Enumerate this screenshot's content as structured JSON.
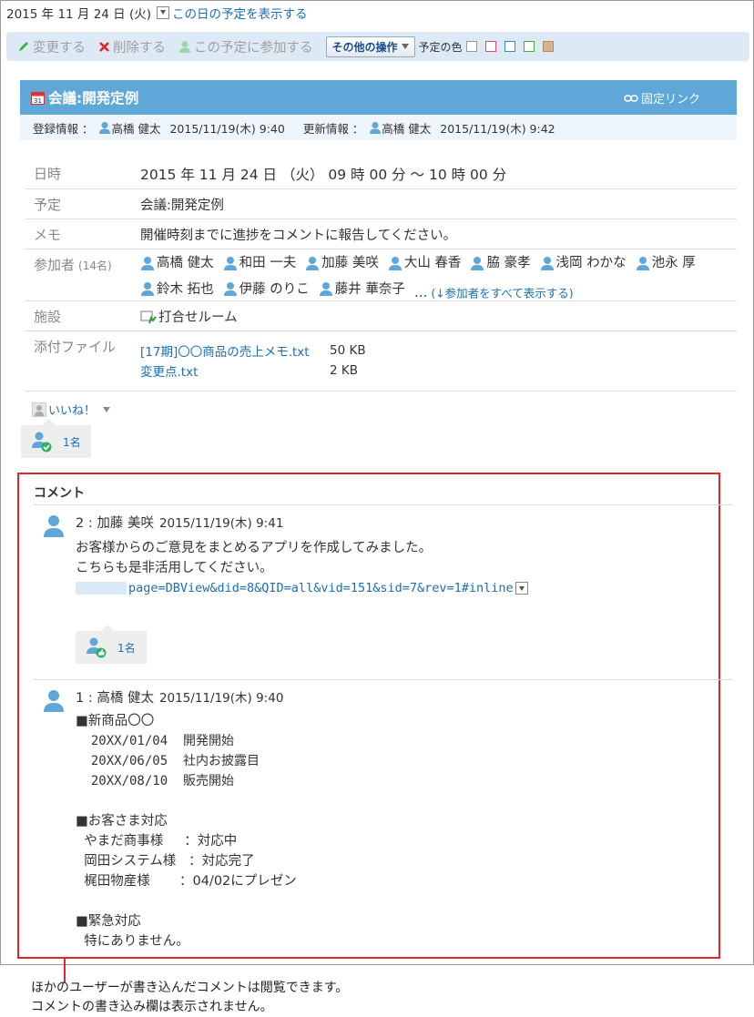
{
  "topbar": {
    "date": "2015 年 11 月 24 日 (火)",
    "show_link": "この日の予定を表示する"
  },
  "toolbar": {
    "edit": "変更する",
    "delete": "削除する",
    "join": "この予定に参加する",
    "more": "その他の操作",
    "color_label": "予定の色",
    "colors": [
      "#999999",
      "#e8457a",
      "#2f8fd6",
      "#3cb34a",
      "#b78a5c"
    ]
  },
  "header": {
    "title": "会議:開発定例",
    "fixed_link": "固定リンク"
  },
  "info": {
    "reg_label": "登録情報 ：",
    "reg_user": "高橋 健太",
    "reg_date": "2015/11/19(木) 9:40",
    "upd_label": "更新情報 ：",
    "upd_user": "高橋 健太",
    "upd_date": "2015/11/19(木) 9:42"
  },
  "details": {
    "datetime_label": "日時",
    "datetime_value": "2015 年 11 月 24 日 （火） 09 時 00 分 ～ 10 時 00 分",
    "plan_label": "予定",
    "plan_value": "会議:開発定例",
    "memo_label": "メモ",
    "memo_value": "開催時刻までに進捗をコメントに報告してください。",
    "participants_label": "参加者",
    "participants_count": "(14名)",
    "participants": [
      "高橋 健太",
      "和田 一夫",
      "加藤 美咲",
      "大山 春香",
      "脇 豪孝",
      "浅岡 わかな",
      "池永 厚",
      "鈴木 拓也",
      "伊藤 のりこ",
      "藤井 華奈子"
    ],
    "more_dots": "…",
    "show_all": "(↓参加者をすべて表示する)",
    "facility_label": "施設",
    "facility_value": "打合せルーム",
    "files_label": "添付ファイル",
    "files": [
      {
        "name": "[17期]〇〇商品の売上メモ.txt",
        "size": "50 KB"
      },
      {
        "name": "変更点.txt",
        "size": "2 KB"
      }
    ]
  },
  "like": {
    "label": "いいね！",
    "count": "1名"
  },
  "comments": {
    "title": "コメント",
    "items": [
      {
        "head": "2 : 加藤 美咲",
        "date": "2015/11/19(木) 9:41",
        "line1": "お客様からのご意見をまとめるアプリを作成してみました。",
        "line2": "こちらも是非活用してください。",
        "url": "page=DBView&did=8&QID=all&vid=151&sid=7&rev=1#inline",
        "like_count": "1名"
      },
      {
        "head": "1 : 高橋 健太",
        "date": "2015/11/19(木) 9:40",
        "body": [
          "■新商品〇〇",
          "  20XX/01/04  開発開始",
          "  20XX/06/05  社内お披露目",
          "  20XX/08/10  販売開始",
          "",
          "■お客さま対応",
          "  やまだ商事様     ：対応中",
          "  岡田システム様   ：対応完了",
          "  梶田物産様       ：04/02にプレゼン",
          "",
          "■緊急対応",
          "  特にありません。"
        ]
      }
    ]
  },
  "caption": {
    "line1": "ほかのユーザーが書き込んだコメントは閲覧できます。",
    "line2": "コメントの書き込み欄は表示されません。"
  }
}
